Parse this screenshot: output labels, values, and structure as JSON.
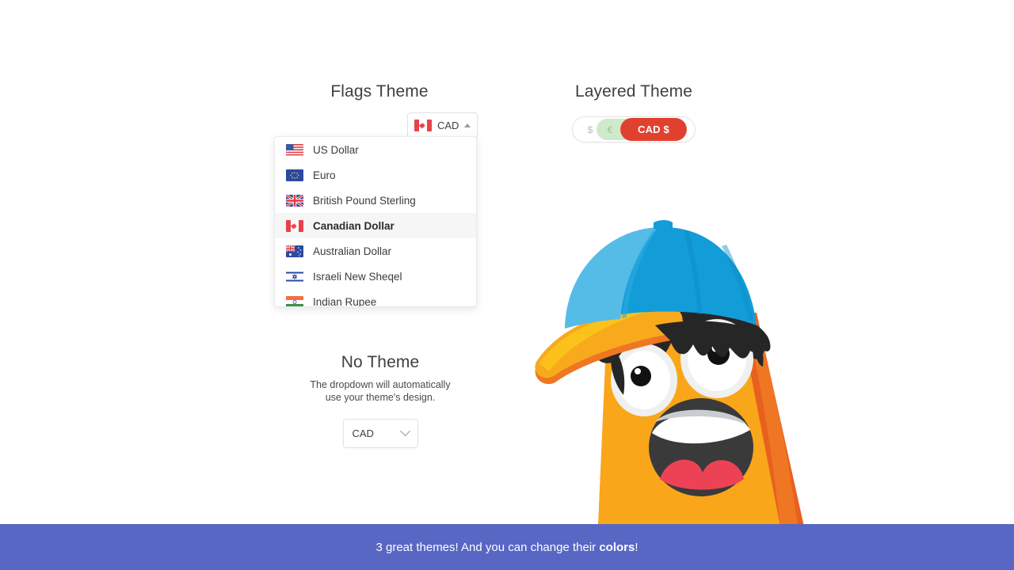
{
  "colors": {
    "banner_bg": "#5866c4",
    "active_pill": "#e0412e",
    "second_pill": "#cfeaca",
    "mascot_body": "#f9a61a",
    "mascot_body_shadow": "#e8601f",
    "cap_light": "#55bce8",
    "cap_dark": "#129dd9",
    "brim": "#f8a91c",
    "hair": "#2b2b2b",
    "tongue": "#ed4256"
  },
  "flags_theme": {
    "title": "Flags Theme",
    "trigger": {
      "label": "CAD",
      "flag": "flag-ca",
      "caret_icon": "caret-up-icon"
    },
    "menu_items": [
      {
        "label": "US Dollar",
        "flag": "flag-us",
        "selected": false
      },
      {
        "label": "Euro",
        "flag": "flag-eu",
        "selected": false
      },
      {
        "label": "British Pound Sterling",
        "flag": "flag-gb",
        "selected": false
      },
      {
        "label": "Canadian Dollar",
        "flag": "flag-ca",
        "selected": true
      },
      {
        "label": "Australian Dollar",
        "flag": "flag-au",
        "selected": false
      },
      {
        "label": "Israeli New Sheqel",
        "flag": "flag-il",
        "selected": false
      },
      {
        "label": "Indian Rupee",
        "flag": "flag-in",
        "selected": false
      }
    ]
  },
  "layered_theme": {
    "title": "Layered Theme",
    "options": [
      {
        "label": "$",
        "name": "usd"
      },
      {
        "label": "€",
        "name": "eur"
      },
      {
        "label": "CAD $",
        "name": "cad",
        "active": true
      },
      {
        "label": "£",
        "name": "gbp"
      }
    ]
  },
  "no_theme": {
    "title": "No Theme",
    "subtitle": "The dropdown will automatically use your theme's design.",
    "select_value": "CAD",
    "chevron_icon": "chevron-down-icon"
  },
  "banner": {
    "text_before": "3 great themes! And you can change their ",
    "text_highlight": "colors",
    "text_after": "!"
  },
  "mascot": {
    "name": "surprised-orange-mascot",
    "description": "Orange character with blue baseball cap, black hair, wide eyes and open mouth"
  }
}
